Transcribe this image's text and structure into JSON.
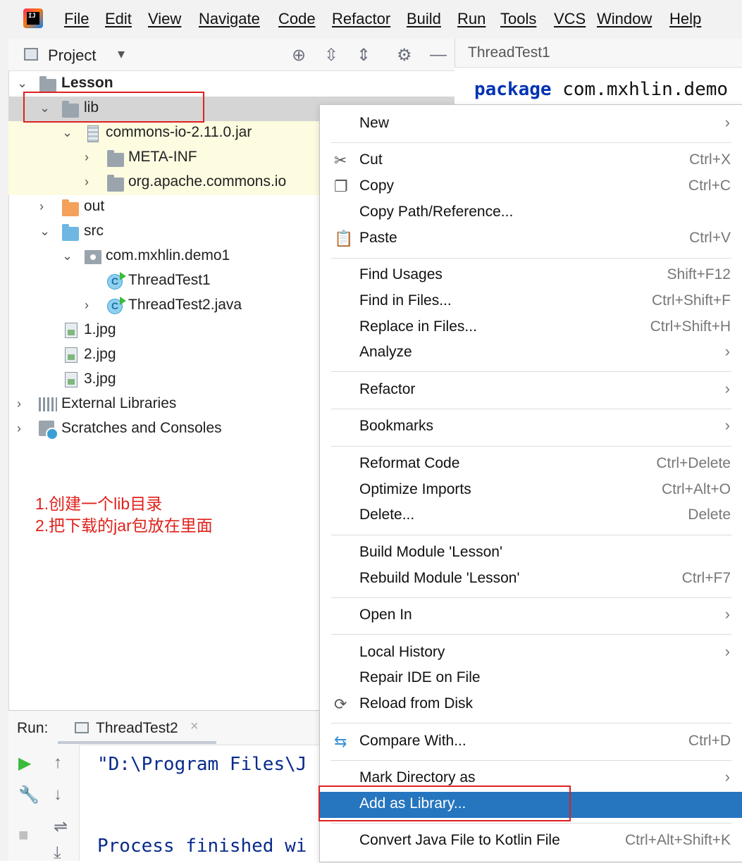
{
  "menubar": {
    "logo": "IJ",
    "items": [
      "File",
      "Edit",
      "View",
      "Navigate",
      "Code",
      "Refactor",
      "Build",
      "Run",
      "Tools",
      "VCS",
      "Window",
      "Help"
    ]
  },
  "project_panel": {
    "title": "Project",
    "icons": [
      "crosshair-icon",
      "expand-icon",
      "collapse-icon",
      "gear-icon",
      "minimize-icon"
    ]
  },
  "editor": {
    "tab": "ThreadTest1",
    "code_keyword": "package",
    "code_rest": " com.mxhlin.demo"
  },
  "tree": [
    {
      "label": "Lesson",
      "icon": "module-folder-icon",
      "bold": true
    },
    {
      "label": "lib",
      "icon": "folder-icon"
    },
    {
      "label": "commons-io-2.11.0.jar",
      "icon": "jar-icon"
    },
    {
      "label": "META-INF",
      "icon": "folder-icon"
    },
    {
      "label": "org.apache.commons.io",
      "icon": "folder-icon"
    },
    {
      "label": "out",
      "icon": "orange-folder-icon"
    },
    {
      "label": "src",
      "icon": "source-folder-icon"
    },
    {
      "label": "com.mxhlin.demo1",
      "icon": "package-icon"
    },
    {
      "label": "ThreadTest1",
      "icon": "java-class-icon"
    },
    {
      "label": "ThreadTest2.java",
      "icon": "java-class-icon"
    },
    {
      "label": "1.jpg",
      "icon": "image-file-icon"
    },
    {
      "label": "2.jpg",
      "icon": "image-file-icon"
    },
    {
      "label": "3.jpg",
      "icon": "image-file-icon"
    },
    {
      "label": "External Libraries",
      "icon": "libraries-icon"
    },
    {
      "label": "Scratches and Consoles",
      "icon": "scratches-icon"
    }
  ],
  "annotation": {
    "line1": "1.创建一个lib目录",
    "line2": "2.把下载的jar包放在里面",
    "color": "#e0211c"
  },
  "run_panel": {
    "label": "Run:",
    "tab": "ThreadTest2",
    "close": "×",
    "console_line1": "\"D:\\Program Files\\J",
    "console_line2": "Process finished wi"
  },
  "context_menu": {
    "items": {
      "new": {
        "label": "New"
      },
      "cut": {
        "label": "Cut",
        "shortcut": "Ctrl+X"
      },
      "copy": {
        "label": "Copy",
        "shortcut": "Ctrl+C"
      },
      "copy_path": {
        "label": "Copy Path/Reference..."
      },
      "paste": {
        "label": "Paste",
        "shortcut": "Ctrl+V"
      },
      "find_usages": {
        "label": "Find Usages",
        "shortcut": "Shift+F12"
      },
      "find_in_files": {
        "label": "Find in Files...",
        "shortcut": "Ctrl+Shift+F"
      },
      "replace_in_files": {
        "label": "Replace in Files...",
        "shortcut": "Ctrl+Shift+H"
      },
      "analyze": {
        "label": "Analyze"
      },
      "refactor": {
        "label": "Refactor"
      },
      "bookmarks": {
        "label": "Bookmarks"
      },
      "reformat_code": {
        "label": "Reformat Code",
        "shortcut": "Ctrl+Delete"
      },
      "optimize_imports": {
        "label": "Optimize Imports",
        "shortcut": "Ctrl+Alt+O"
      },
      "delete": {
        "label": "Delete...",
        "shortcut": "Delete"
      },
      "build_module": {
        "label": "Build Module 'Lesson'"
      },
      "rebuild_module": {
        "label": "Rebuild Module 'Lesson'",
        "shortcut": "Ctrl+F7"
      },
      "open_in": {
        "label": "Open In"
      },
      "local_history": {
        "label": "Local History"
      },
      "repair_ide": {
        "label": "Repair IDE on File"
      },
      "reload_from_disk": {
        "label": "Reload from Disk"
      },
      "compare_with": {
        "label": "Compare With...",
        "shortcut": "Ctrl+D"
      },
      "mark_directory": {
        "label": "Mark Directory as"
      },
      "add_as_library": {
        "label": "Add as Library..."
      },
      "convert_kotlin": {
        "label": "Convert Java File to Kotlin File",
        "shortcut": "Ctrl+Alt+Shift+K"
      }
    },
    "highlight_color": "#2675bf"
  }
}
